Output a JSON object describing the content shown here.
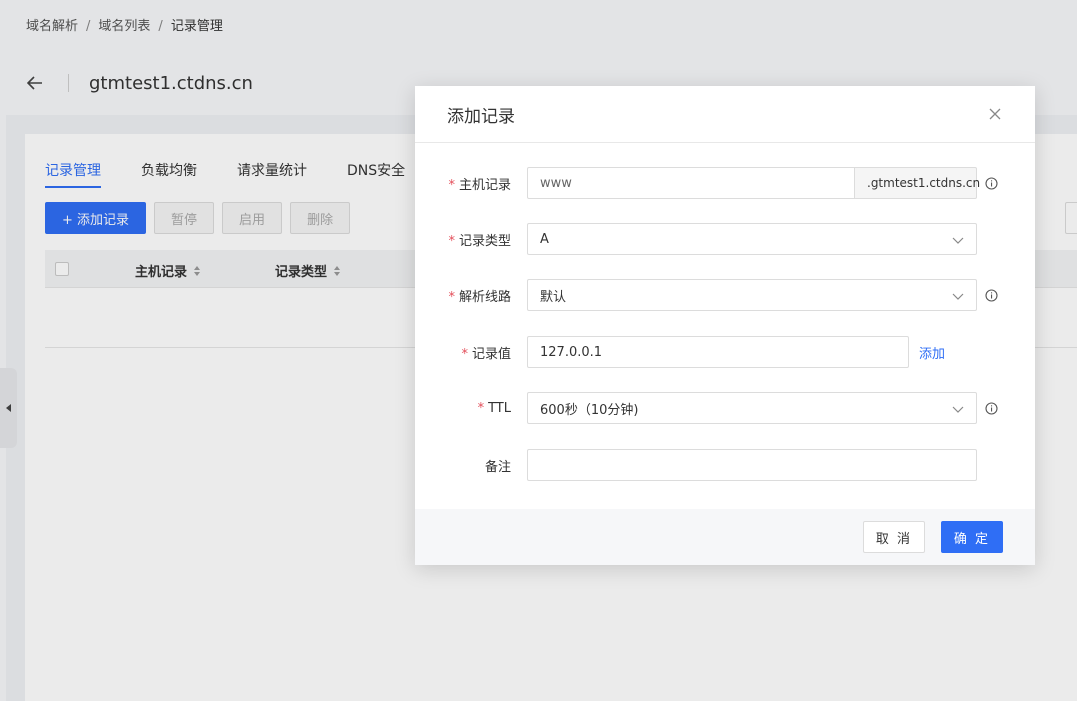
{
  "breadcrumb": {
    "items": [
      "域名解析",
      "域名列表",
      "记录管理"
    ],
    "separator": "/"
  },
  "header": {
    "domain": "gtmtest1.ctdns.cn"
  },
  "tabs": [
    {
      "label": "记录管理",
      "active": true
    },
    {
      "label": "负载均衡",
      "active": false
    },
    {
      "label": "请求量统计",
      "active": false
    },
    {
      "label": "DNS安全",
      "active": false
    }
  ],
  "toolbar": {
    "add_label": "+ 添加记录",
    "pause_label": "暂停",
    "enable_label": "启用",
    "delete_label": "删除"
  },
  "table": {
    "columns": [
      "主机记录",
      "记录类型"
    ]
  },
  "modal": {
    "title": "添加记录",
    "fields": {
      "host": {
        "label": "主机记录",
        "value": "www",
        "suffix": ".gtmtest1.ctdns.cn",
        "required": "*"
      },
      "type": {
        "label": "记录类型",
        "value": "A",
        "required": "*"
      },
      "line": {
        "label": "解析线路",
        "value": "默认",
        "required": "*"
      },
      "value": {
        "label": "记录值",
        "value": "127.0.0.1",
        "add_label": "添加",
        "required": "*"
      },
      "ttl": {
        "label": "TTL",
        "value": "600秒（10分钟)",
        "required": "*"
      },
      "remark": {
        "label": "备注",
        "value": ""
      }
    },
    "cancel_label": "取 消",
    "ok_label": "确 定"
  },
  "colors": {
    "primary": "#2f6ef5",
    "required": "#e34d59"
  },
  "icons": [
    "back-arrow-icon",
    "close-icon",
    "chevron-down-icon",
    "info-icon",
    "sort-icon",
    "collapse-left-icon"
  ]
}
